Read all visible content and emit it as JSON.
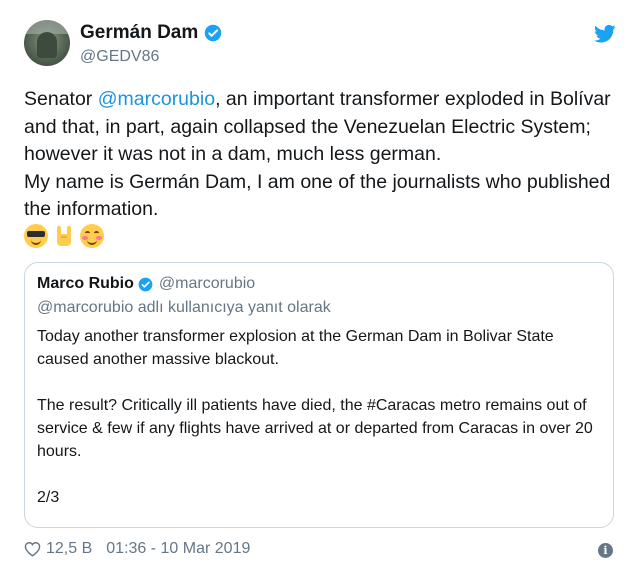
{
  "author": {
    "name": "Germán Dam",
    "handle": "@GEDV86"
  },
  "tweet": {
    "line1_pre": "Senator ",
    "mention": "@marcorubio",
    "line1_post": ", an important transformer exploded in Bolívar and that, in part, again collapsed the Venezuelan Electric System; however it was not in a dam, much less german.",
    "line2": "My name is Germán Dam, I am one of the journalists who published the information.",
    "emojis": [
      "smiling-face-with-sunglasses",
      "sign-of-the-horns",
      "smiling-face-with-blush"
    ]
  },
  "quoted": {
    "name": "Marco Rubio",
    "handle": "@marcorubio",
    "reply_context": "@marcorubio adlı kullanıcıya yanıt olarak",
    "paragraphs": [
      "Today another transformer explosion at the German Dam in Bolivar State caused another massive blackout.",
      "The result? Critically ill patients have died, the #Caracas metro remains out of service & few if any flights have arrived at or departed from Caracas in over 20 hours.",
      "2/3"
    ]
  },
  "footer": {
    "likes": "12,5 B",
    "timestamp": "01:36 - 10 Mar 2019"
  },
  "colors": {
    "accent": "#1da1f2",
    "link": "#1b95e0",
    "muted": "#657786",
    "border": "#ccd6dd"
  }
}
